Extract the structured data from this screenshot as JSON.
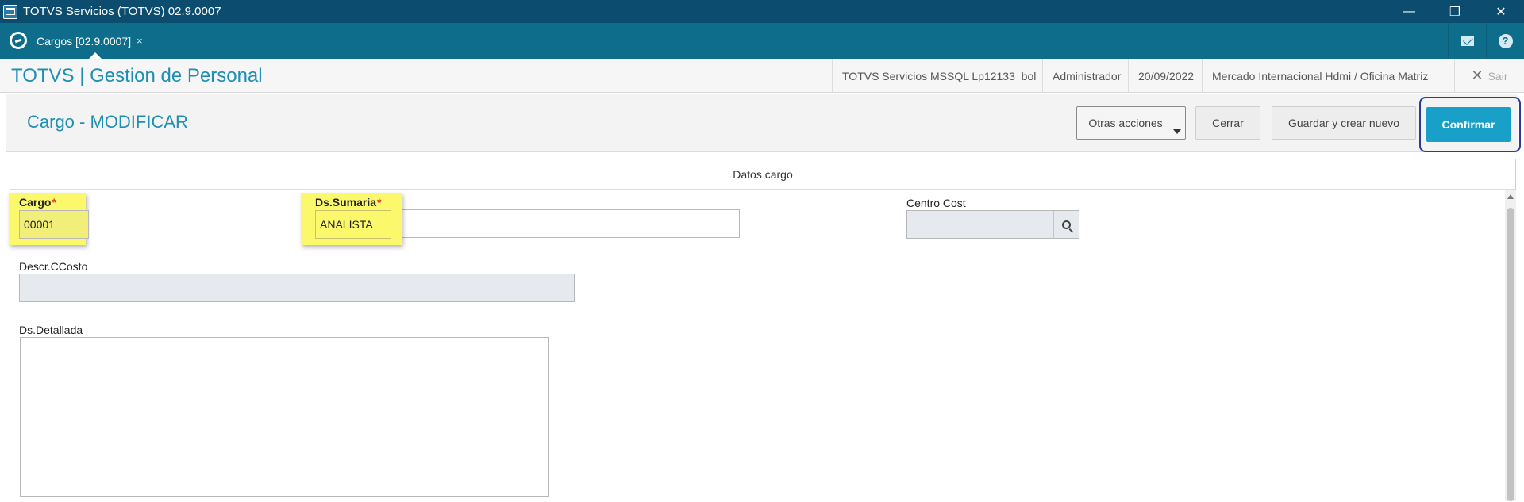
{
  "window": {
    "title": "TOTVS Servicios (TOTVS) 02.9.0007",
    "minimize": "—",
    "restore": "❐",
    "close": "✕"
  },
  "tabbar": {
    "active_tab": "Cargos [02.9.0007]",
    "tab_close": "×"
  },
  "module": {
    "title": "TOTVS | Gestion de Personal",
    "environment": "TOTVS Servicios MSSQL Lp12133_bol",
    "user": "Administrador",
    "date": "20/09/2022",
    "company": "Mercado Internacional Hdmi / Oficina Matriz",
    "logout": "Sair"
  },
  "form": {
    "title": "Cargo - MODIFICAR",
    "actions": {
      "other": "Otras acciones",
      "close": "Cerrar",
      "save_new": "Guardar y crear nuevo",
      "confirm": "Confirmar"
    },
    "section_title": "Datos cargo",
    "fields": {
      "cargo": {
        "label": "Cargo",
        "value": "00001",
        "required_mark": "*"
      },
      "ds_sumaria": {
        "label": "Ds.Sumaria",
        "value": "ANALISTA",
        "required_mark": "*"
      },
      "centro_cost": {
        "label": "Centro Cost",
        "value": ""
      },
      "descr_ccosto": {
        "label": "Descr.CCosto",
        "value": ""
      },
      "ds_detallada": {
        "label": "Ds.Detallada",
        "value": ""
      }
    }
  },
  "colors": {
    "accent": "#1d8fb3",
    "confirm": "#19a0c9",
    "highlight": "#fbf86b",
    "titlebar": "#0c4d6f",
    "tabbar": "#0d6d8b"
  }
}
